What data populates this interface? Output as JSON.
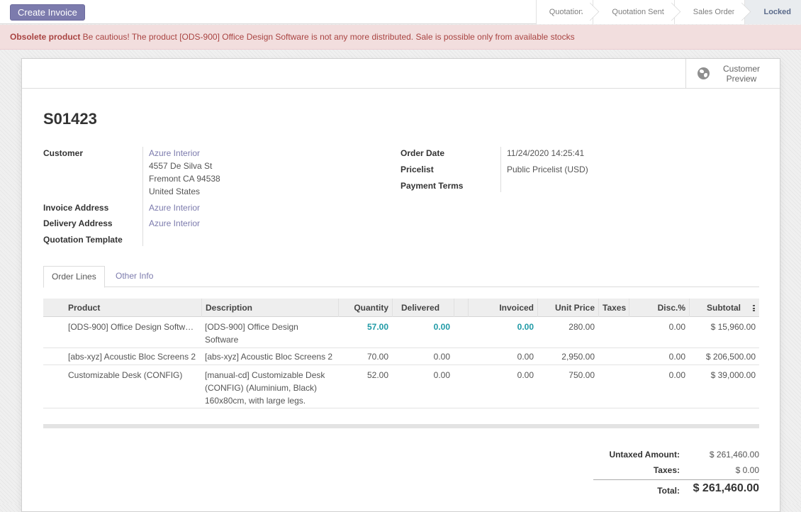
{
  "statusbar": {
    "create_invoice": "Create Invoice",
    "stages": [
      "Quotation",
      "Quotation Sent",
      "Sales Order",
      "Locked"
    ],
    "active_stage": "Locked"
  },
  "alert": {
    "title": "Obsolete product",
    "message": " Be cautious! The product [ODS-900] Office Design Software is not any more distributed. Sale is possible only from available stocks"
  },
  "smart_button": {
    "label": "Customer Preview",
    "icon": "globe-icon"
  },
  "order": {
    "name": "S01423",
    "customer_label": "Customer",
    "customer_name": "Azure Interior",
    "customer_address": [
      "4557 De Silva St",
      "Fremont CA 94538",
      "United States"
    ],
    "invoice_address_label": "Invoice Address",
    "invoice_address": "Azure Interior",
    "delivery_address_label": "Delivery Address",
    "delivery_address": "Azure Interior",
    "quotation_template_label": "Quotation Template",
    "order_date_label": "Order Date",
    "order_date": "11/24/2020 14:25:41",
    "pricelist_label": "Pricelist",
    "pricelist": "Public Pricelist (USD)",
    "payment_terms_label": "Payment Terms"
  },
  "tabs": [
    "Order Lines",
    "Other Info"
  ],
  "table": {
    "headers": [
      "Product",
      "Description",
      "Quantity",
      "Delivered",
      "Invoiced",
      "Unit Price",
      "Taxes",
      "Disc.%",
      "Subtotal"
    ],
    "rows": [
      {
        "product": "[ODS-900] Office Design Softw…",
        "description": "[ODS-900] Office Design Software",
        "quantity": "57.00",
        "delivered": "0.00",
        "invoiced": "0.00",
        "unit_price": "280.00",
        "taxes": "",
        "discount": "0.00",
        "subtotal": "$ 15,960.00"
      },
      {
        "product": "[abs-xyz] Acoustic Bloc Screens 2",
        "description": "[abs-xyz] Acoustic Bloc Screens 2",
        "quantity": "70.00",
        "delivered": "0.00",
        "invoiced": "0.00",
        "unit_price": "2,950.00",
        "taxes": "",
        "discount": "0.00",
        "subtotal": "$ 206,500.00"
      },
      {
        "product": "Customizable Desk (CONFIG)",
        "description": "[manual-cd] Customizable Desk (CONFIG) (Aluminium, Black) 160x80cm, with large legs.",
        "quantity": "52.00",
        "delivered": "0.00",
        "invoiced": "0.00",
        "unit_price": "750.00",
        "taxes": "",
        "discount": "0.00",
        "subtotal": "$ 39,000.00"
      }
    ]
  },
  "totals": {
    "untaxed_label": "Untaxed Amount:",
    "untaxed": "$ 261,460.00",
    "taxes_label": "Taxes:",
    "taxes": "$ 0.00",
    "total_label": "Total:",
    "total": "$ 261,460.00"
  },
  "colors": {
    "primary": "#7c7bad",
    "alert_bg": "#f2dede",
    "alert_text": "#a94442",
    "highlight_number": "#1f9aa6"
  }
}
